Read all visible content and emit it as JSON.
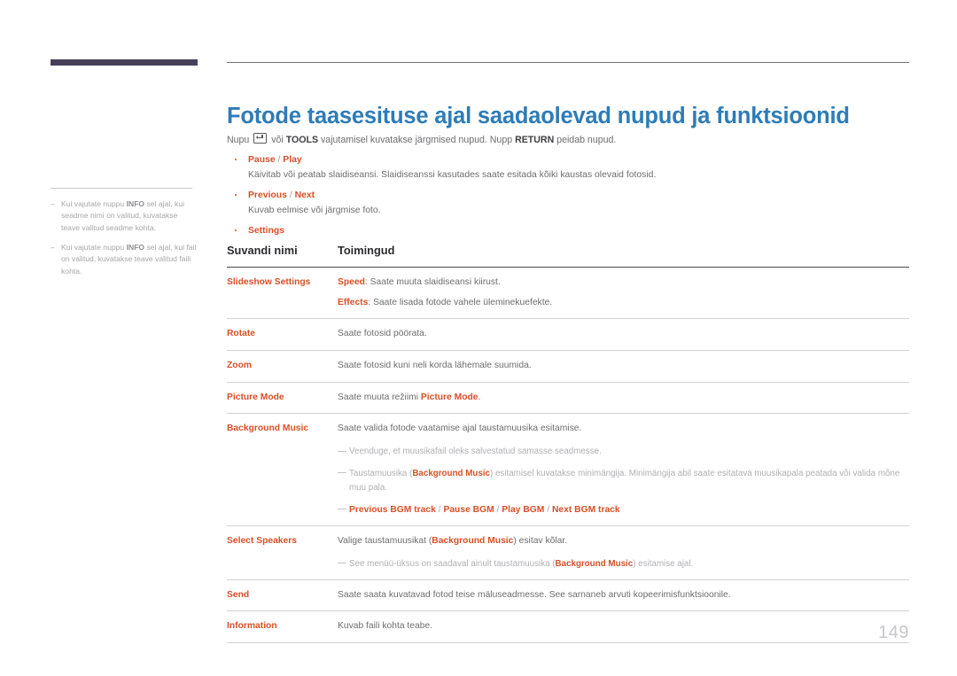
{
  "colors": {
    "title_blue": "#2e7cb8",
    "accent_orange": "#d94f27",
    "deco_bar": "#474059",
    "body_gray": "#6d6d70",
    "note_gray": "#b0b0b4",
    "page_number_gray": "#c7c7cb"
  },
  "header": {
    "title": "Fotode taasesituse ajal saadaolevad nupud ja funktsioonid"
  },
  "intro": {
    "prefix": "Nupu",
    "key_icon": "enter-key-icon",
    "middle": "või",
    "tools_label": "TOOLS",
    "after_tools": "vajutamisel kuvatakse järgmised nupud. Nupp",
    "return_label": "RETURN",
    "suffix": "peidab nupud."
  },
  "sidenote": {
    "items": [
      {
        "pre": "Kui vajutate nuppu ",
        "bold": "INFO",
        "post": " sel ajal, kui seadme nimi on valitud, kuvatakse teave valitud seadme kohta."
      },
      {
        "pre": "Kui vajutate nuppu ",
        "bold": "INFO",
        "post": " sel ajal, kui fail on valitud, kuvatakse teave valitud faili kohta."
      }
    ]
  },
  "bullets": [
    {
      "head_a": "Pause",
      "head_sep": " / ",
      "head_b": "Play",
      "body": "Käivitab või peatab slaidiseansi. Slaidiseanssi kasutades saate esitada kõiki kaustas olevaid fotosid."
    },
    {
      "head_a": "Previous",
      "head_sep": " / ",
      "head_b": "Next",
      "body": "Kuvab eelmise või järgmise foto."
    },
    {
      "head_a": "Settings",
      "head_sep": "",
      "head_b": "",
      "body": ""
    }
  ],
  "table": {
    "headers": {
      "col1": "Suvandi nimi",
      "col2": "Toimingud"
    },
    "rows": [
      {
        "name": "Slideshow Settings",
        "lines": [
          {
            "hl": "Speed",
            "text": ": Saate muuta slaidiseansi kiirust."
          },
          {
            "hl": "Effects",
            "text": ": Saate lisada fotode vahele üleminekuefekte."
          }
        ]
      },
      {
        "name": "Rotate",
        "lines": [
          {
            "hl": "",
            "text": "Saate fotosid pöörata."
          }
        ]
      },
      {
        "name": "Zoom",
        "lines": [
          {
            "hl": "",
            "text": "Saate fotosid kuni neli korda lähemale suumida."
          }
        ]
      },
      {
        "name": "Picture Mode",
        "lines": [
          {
            "hl": "",
            "text": "Saate muuta režiimi ",
            "hl_end": "Picture Mode",
            "tail": "."
          }
        ]
      },
      {
        "name": "Background Music",
        "lines": [
          {
            "hl": "",
            "text": "Saate valida fotode vaatamise ajal taustamuusika esitamise."
          }
        ],
        "notes": [
          {
            "pre": "Veenduge, et muusikafail oleks salvestatud samasse seadmesse.",
            "hl": "",
            "post": ""
          },
          {
            "pre": "Taustamuusika (",
            "hl": "Background Music",
            "post": ") esitamisel kuvatakse minimängija. Minimängija abil saate esitatava muusikapala peatada või valida mõne muu pala."
          }
        ],
        "subnote": {
          "a": "Previous BGM track",
          "s1": " / ",
          "b": "Pause BGM",
          "s2": " / ",
          "c": "Play BGM",
          "s3": " / ",
          "d": "Next BGM track"
        }
      },
      {
        "name": "Select Speakers",
        "lines": [
          {
            "hl": "",
            "text": "Valige taustamuusikat (",
            "hl_end": "Background Music",
            "tail": ") esitav kõlar."
          }
        ],
        "notes": [
          {
            "pre": "See menüü-üksus on saadaval ainult taustamuusika (",
            "hl": "Background Music",
            "post": ") esitamise ajal."
          }
        ]
      },
      {
        "name": "Send",
        "lines": [
          {
            "hl": "",
            "text": "Saate saata kuvatavad fotod teise mäluseadmesse. See sarnaneb arvuti kopeerimisfunktsioonile."
          }
        ]
      },
      {
        "name": "Information",
        "lines": [
          {
            "hl": "",
            "text": "Kuvab faili kohta teabe."
          }
        ]
      }
    ]
  },
  "footer": {
    "page_number": "149"
  }
}
